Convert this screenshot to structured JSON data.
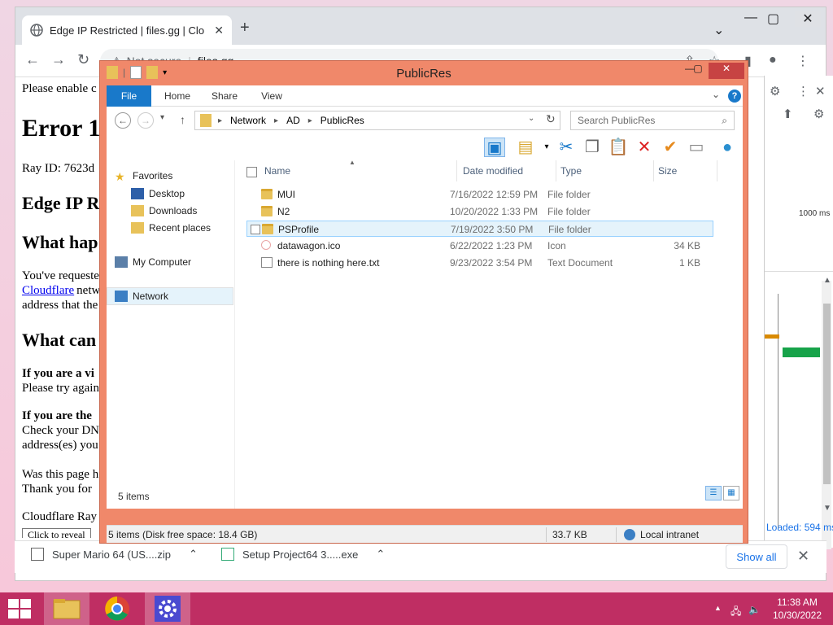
{
  "chrome": {
    "tab_title": "Edge IP Restricted | files.gg | Clo",
    "omnibox_security": "Not secure",
    "omnibox_host": "files.gg"
  },
  "webpage": {
    "line1": "Please enable c",
    "h1": "Error 1",
    "ray_line": "Ray ID: 7623d",
    "h2a": "Edge IP R",
    "h2b": "What hap",
    "para1": "You've requeste",
    "link": "Cloudflare",
    "para1b": "netw",
    "para1c": "address that the",
    "h2c": "What can",
    "bold1": "If you are a vi",
    "para2": "Please try again",
    "bold2": "If you are the",
    "para3": "Check your DN",
    "para3b": "address(es) you",
    "para4": "Was this page h",
    "para5": "Thank you for",
    "footer": "Cloudflare Ray",
    "footer2": "Click to reveal"
  },
  "devtools": {
    "time_label": "1000 ms",
    "loaded_text": "Loaded: 594 ms"
  },
  "downloads": {
    "items": [
      {
        "name": "Super Mario 64 (US....zip"
      },
      {
        "name": "Setup Project64 3.....exe"
      }
    ],
    "show_all": "Show all"
  },
  "explorer": {
    "title": "PublicRes",
    "ribbon_tabs": [
      "File",
      "Home",
      "Share",
      "View"
    ],
    "breadcrumb": [
      "Network",
      "AD",
      "PublicRes"
    ],
    "search_placeholder": "Search PublicRes",
    "nav": {
      "favorites": "Favorites",
      "desktop": "Desktop",
      "downloads": "Downloads",
      "recent": "Recent places",
      "computer": "My Computer",
      "network": "Network"
    },
    "columns": [
      "Name",
      "Date modified",
      "Type",
      "Size"
    ],
    "files": [
      {
        "name": "MUI",
        "date": "7/16/2022 12:59 PM",
        "type": "File folder",
        "size": "",
        "kind": "folder"
      },
      {
        "name": "N2",
        "date": "10/20/2022 1:33 PM",
        "type": "File folder",
        "size": "",
        "kind": "folder"
      },
      {
        "name": "PSProfile",
        "date": "7/19/2022 3:50 PM",
        "type": "File folder",
        "size": "",
        "kind": "folder",
        "selected": true
      },
      {
        "name": "datawagon.ico",
        "date": "6/22/2022 1:23 PM",
        "type": "Icon",
        "size": "34 KB",
        "kind": "ico"
      },
      {
        "name": "there is nothing here.txt",
        "date": "9/23/2022 3:54 PM",
        "type": "Text Document",
        "size": "1 KB",
        "kind": "txt"
      }
    ],
    "items_count": "5 items",
    "status_left": "5 items (Disk free space: 18.4 GB)",
    "status_size": "33.7 KB",
    "status_zone": "Local intranet"
  },
  "taskbar": {
    "time": "11:38 AM",
    "date": "10/30/2022"
  },
  "colors": {
    "explorer_frame": "#f0886a",
    "taskbar": "#bf2e63",
    "ribbon_file": "#1979ca"
  }
}
